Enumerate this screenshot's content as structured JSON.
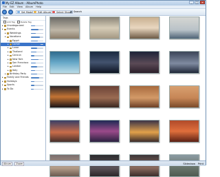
{
  "window": {
    "title": "My EZ Album - AlbumPhoto"
  },
  "menu": [
    "File",
    "Edit",
    "View",
    "Album",
    "Help"
  ],
  "toolbar": {
    "set_mode": "Set Mode",
    "edit_album": "Edit Album",
    "select_show": "Select Show",
    "search": "Search"
  },
  "sidebar": {
    "header": "Tags",
    "filters": [
      "Add Tag",
      "Delete Tag"
    ],
    "tree": [
      {
        "label": "Uncategorized",
        "indent": 0,
        "level": 0.35,
        "selected": false
      },
      {
        "label": "Events",
        "indent": 0,
        "level": 0.6,
        "selected": false
      },
      {
        "label": "Weddings",
        "indent": 1,
        "level": 0.4,
        "selected": false
      },
      {
        "label": "Vacations",
        "indent": 1,
        "level": 0.7,
        "selected": false
      },
      {
        "label": "Egypt",
        "indent": 2,
        "level": 0.55,
        "selected": false
      },
      {
        "label": "Camel",
        "indent": 2,
        "level": 0.8,
        "selected": true
      },
      {
        "label": "Luxor",
        "indent": 2,
        "level": 0.5,
        "selected": false
      },
      {
        "label": "Thailand",
        "indent": 2,
        "level": 0.45,
        "selected": false
      },
      {
        "label": "Cancun",
        "indent": 2,
        "level": 0.3,
        "selected": false
      },
      {
        "label": "New York",
        "indent": 2,
        "level": 0.6,
        "selected": false
      },
      {
        "label": "San Francisco",
        "indent": 2,
        "level": 0.4,
        "selected": false
      },
      {
        "label": "London",
        "indent": 2,
        "level": 0.5,
        "selected": false
      },
      {
        "label": "Italy",
        "indent": 2,
        "level": 0.35,
        "selected": false
      },
      {
        "label": "Birthday Party",
        "indent": 1,
        "level": 0.5,
        "selected": false
      },
      {
        "label": "Family and Friends",
        "indent": 0,
        "level": 0.65,
        "selected": false
      },
      {
        "label": "Holidays",
        "indent": 0,
        "level": 0.3,
        "selected": false
      },
      {
        "label": "Sports",
        "indent": 0,
        "level": 0.25,
        "selected": false
      },
      {
        "label": "To Do",
        "indent": 0,
        "level": 0.2,
        "selected": false
      }
    ]
  },
  "thumbnails": [
    {
      "name": "photo-people-hands",
      "bg": "linear-gradient(#6b6a66,#bfb7a8 60%,#8b7d6a)"
    },
    {
      "name": "photo-rocks-desert",
      "bg": "linear-gradient(#8a8477,#d7cdb8 50%,#a39782)"
    },
    {
      "name": "photo-child-portrait",
      "bg": "linear-gradient(#c9b090,#e9d7c0 50%,#6d5a45)"
    },
    {
      "name": "photo-sailboat-sea",
      "bg": "linear-gradient(#d5d6d2,#b9c2c8 60%,#4e6376)"
    },
    {
      "name": "photo-pool-blue",
      "bg": "linear-gradient(#2f6b8c,#66a7c7 50%,#b9dbe6)"
    },
    {
      "name": "photo-palm-sunset",
      "bg": "linear-gradient(#1a2a40,#43536e 50%,#0d1422)"
    },
    {
      "name": "photo-person-sunset",
      "bg": "linear-gradient(#1d2338,#5b4a56 55%,#2a1f2a)"
    },
    {
      "name": "photo-sailboat-dusk",
      "bg": "linear-gradient(#3b4558,#7f8aa0 55%,#1f2738)"
    },
    {
      "name": "photo-sunset-horizon",
      "bg": "linear-gradient(#2a2428,#c47434 50%,#1b1416)"
    },
    {
      "name": "photo-river-dusk",
      "bg": "linear-gradient(#6b4236,#9a6b52 55%,#3a2720)"
    },
    {
      "name": "photo-hazy-orange",
      "bg": "linear-gradient(#a86a3e,#d39a68 55%,#6c3f26)"
    },
    {
      "name": "photo-boat-horizon",
      "bg": "linear-gradient(#d8a070,#c78656 55%,#7a4a2a)"
    },
    {
      "name": "photo-balloon-crowd",
      "bg": "linear-gradient(#3a3f66,#c96d4a 55%,#452e2a)"
    },
    {
      "name": "photo-balloon-night",
      "bg": "linear-gradient(#1f2a55,#9b4a8a 50%,#2a2140)"
    },
    {
      "name": "photo-balloon-glow",
      "bg": "linear-gradient(#3b3448,#e2a14a 55%,#3a2a2a)"
    },
    {
      "name": "photo-red-sunset",
      "bg": "linear-gradient(#b04a2a,#e06f3c 50%,#5a2014)"
    },
    {
      "name": "photo-balloon-sky",
      "bg": "linear-gradient(#7a6e6e,#b59e8a 60%,#6a5a50)"
    },
    {
      "name": "photo-balloon-dark",
      "bg": "linear-gradient(#2b2b2e,#5b5358 60%,#2a2628)"
    },
    {
      "name": "photo-dusk-plain",
      "bg": "linear-gradient(#3c3538,#8a6b5e 60%,#3a2d2a)"
    },
    {
      "name": "photo-city-aerial",
      "bg": "linear-gradient(#8b9aa3,#6f7b72 50%,#4e5a50)"
    }
  ],
  "status": {
    "left_items": [
      "Album",
      "Zoom"
    ],
    "right_items": [
      "Slideshow",
      "Print"
    ]
  },
  "taskbar": {
    "start": "start",
    "items": [
      "My EZ Album - AlbumPhoto"
    ]
  }
}
